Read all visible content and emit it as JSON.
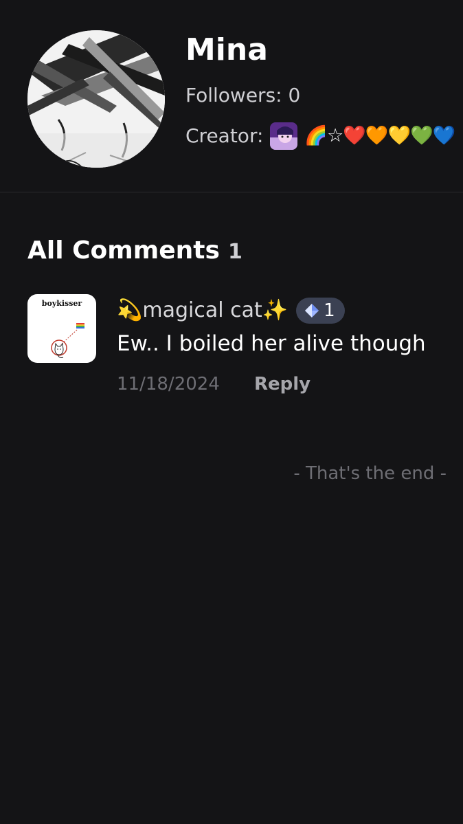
{
  "profile": {
    "name": "Mina",
    "followers": "Followers: 0",
    "creator_label": "Creator:",
    "creator_emojis": "🌈☆❤️🧡💛💚💙"
  },
  "comments": {
    "title": "All Comments",
    "count": "1",
    "items": [
      {
        "username": "💫magical cat✨",
        "avatar_caption": "boykisser",
        "gem_count": "1",
        "text": "Ew.. I boiled her alive though",
        "date": "11/18/2024",
        "reply_label": "Reply"
      }
    ]
  },
  "footer": {
    "end_text": "- That's the end -"
  },
  "colors": {
    "background": "#141416",
    "badge": "#3b4153",
    "muted_text": "#6e6e74"
  }
}
